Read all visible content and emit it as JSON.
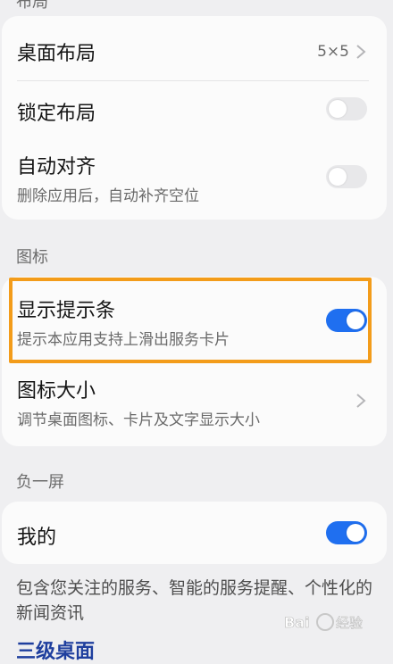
{
  "header_peek": "布局",
  "layout_card": {
    "desktop_layout": {
      "label": "桌面布局",
      "value": "5×5"
    },
    "lock_layout": {
      "label": "锁定布局",
      "enabled": false
    },
    "auto_align": {
      "label": "自动对齐",
      "subtitle": "删除应用后，自动补齐空位",
      "enabled": false
    }
  },
  "icons_section": {
    "title": "图标",
    "show_hint_bar": {
      "label": "显示提示条",
      "subtitle": "提示本应用支持上滑出服务卡片",
      "enabled": true
    },
    "icon_size": {
      "label": "图标大小",
      "subtitle": "调节桌面图标、卡片及文字显示大小"
    }
  },
  "minus_one_section": {
    "title": "负一屏",
    "mine": {
      "label": "我的",
      "enabled": true
    },
    "description": "包含您关注的服务、智能的服务提醒、个性化的新闻资讯"
  },
  "next_peek": "三级桌面",
  "watermark": "Baidu 经验",
  "colors": {
    "accent": "#1f6ff0",
    "highlight": "#f39c1a"
  },
  "icons": {
    "chevron": "chevron-right-icon"
  }
}
